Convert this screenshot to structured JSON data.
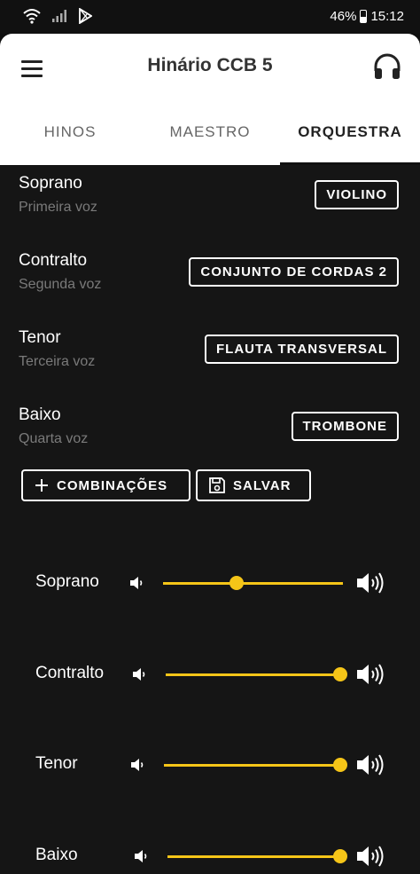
{
  "status_bar": {
    "icons": [
      "wifi-icon",
      "signal-icon",
      "play-store-icon"
    ],
    "battery": "46%",
    "time": "15:12"
  },
  "header": {
    "title": "Hinário CCB 5",
    "menu_icon": "hamburger-menu-icon",
    "action_icon": "headphones-icon"
  },
  "tabs": [
    {
      "label": "HINOS",
      "active": false
    },
    {
      "label": "MAESTRO",
      "active": false
    },
    {
      "label": "ORQUESTRA",
      "active": true
    }
  ],
  "voices": [
    {
      "name": "Soprano",
      "subtitle": "Primeira voz",
      "instrument": "VIOLINO"
    },
    {
      "name": "Contralto",
      "subtitle": "Segunda voz",
      "instrument": "CONJUNTO DE CORDAS 2"
    },
    {
      "name": "Tenor",
      "subtitle": "Terceira voz",
      "instrument": "FLAUTA TRANSVERSAL"
    },
    {
      "name": "Baixo",
      "subtitle": "Quarta voz",
      "instrument": "TROMBONE"
    }
  ],
  "actions": {
    "combinations_label": "COMBINAÇÕES",
    "save_label": "SALVAR"
  },
  "mixer": [
    {
      "label": "Soprano",
      "level": 0.41
    },
    {
      "label": "Contralto",
      "level": 1.0
    },
    {
      "label": "Tenor",
      "level": 1.0
    },
    {
      "label": "Baixo",
      "level": 1.0
    }
  ],
  "colors": {
    "accent": "#f5c518",
    "background": "#151515",
    "header": "#ffffff"
  }
}
